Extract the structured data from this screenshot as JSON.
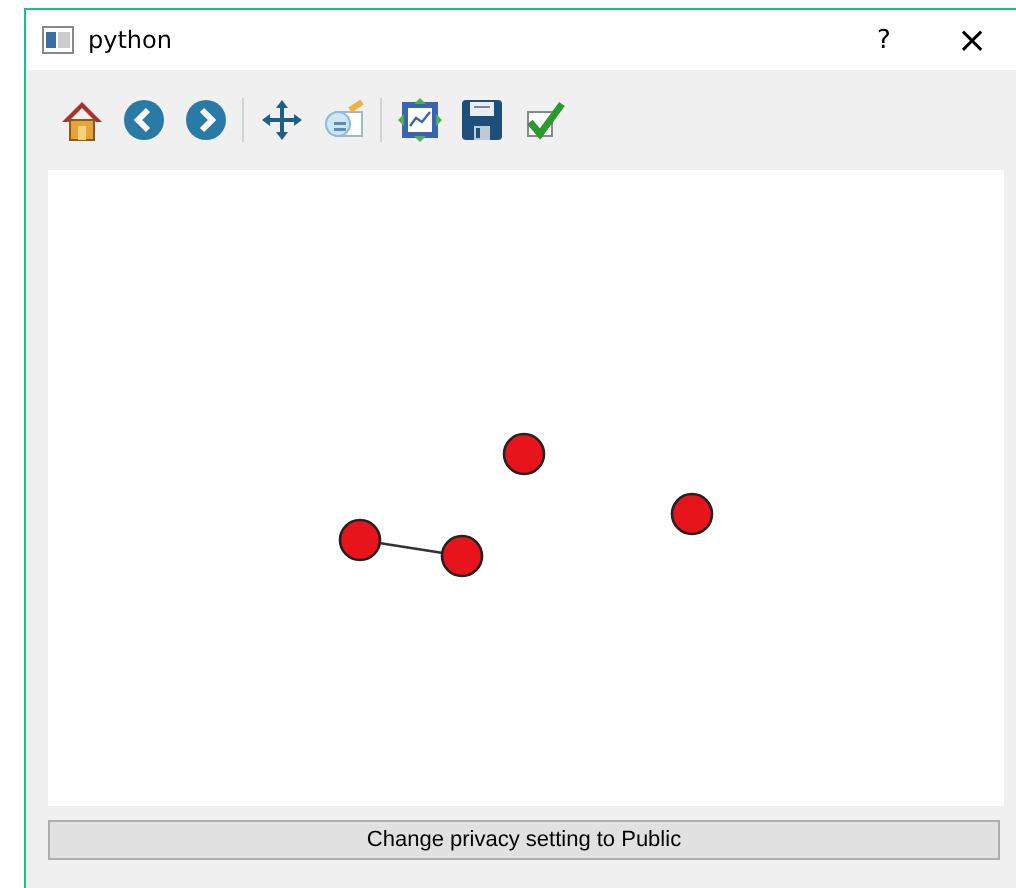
{
  "window": {
    "title": "python",
    "help": "?",
    "close": "×"
  },
  "action_button": {
    "label": "Change privacy setting to Public"
  }
}
